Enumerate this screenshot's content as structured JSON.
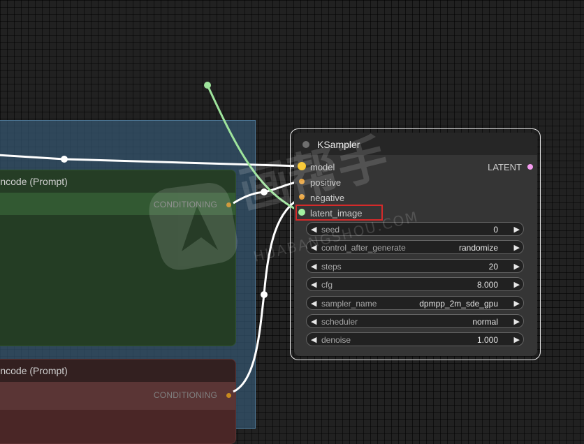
{
  "background_nodes": {
    "green_title": "Encode (Prompt)",
    "green_output": "CONDITIONING",
    "red_title": "Encode (Prompt)",
    "red_output": "CONDITIONING"
  },
  "ksampler": {
    "title": "KSampler",
    "inputs": [
      "model",
      "positive",
      "negative",
      "latent_image"
    ],
    "output": "LATENT",
    "widgets": [
      {
        "name": "seed",
        "value": "0"
      },
      {
        "name": "control_after_generate",
        "value": "randomize"
      },
      {
        "name": "steps",
        "value": "20"
      },
      {
        "name": "cfg",
        "value": "8.000"
      },
      {
        "name": "sampler_name",
        "value": "dpmpp_2m_sde_gpu"
      },
      {
        "name": "scheduler",
        "value": "normal"
      },
      {
        "name": "denoise",
        "value": "1.000"
      }
    ]
  },
  "watermark": {
    "chinese": "画帮手",
    "latin": "HUABANGSHOU.COM"
  },
  "colors": {
    "model_slot": "#f7c21b",
    "conditioning_slot": "#e8a23a",
    "latent_slot": "#a2f0a0",
    "latent_output": "#f59cf0",
    "latent_wire": "#9ee49c",
    "highlight": "#d42a2a"
  }
}
